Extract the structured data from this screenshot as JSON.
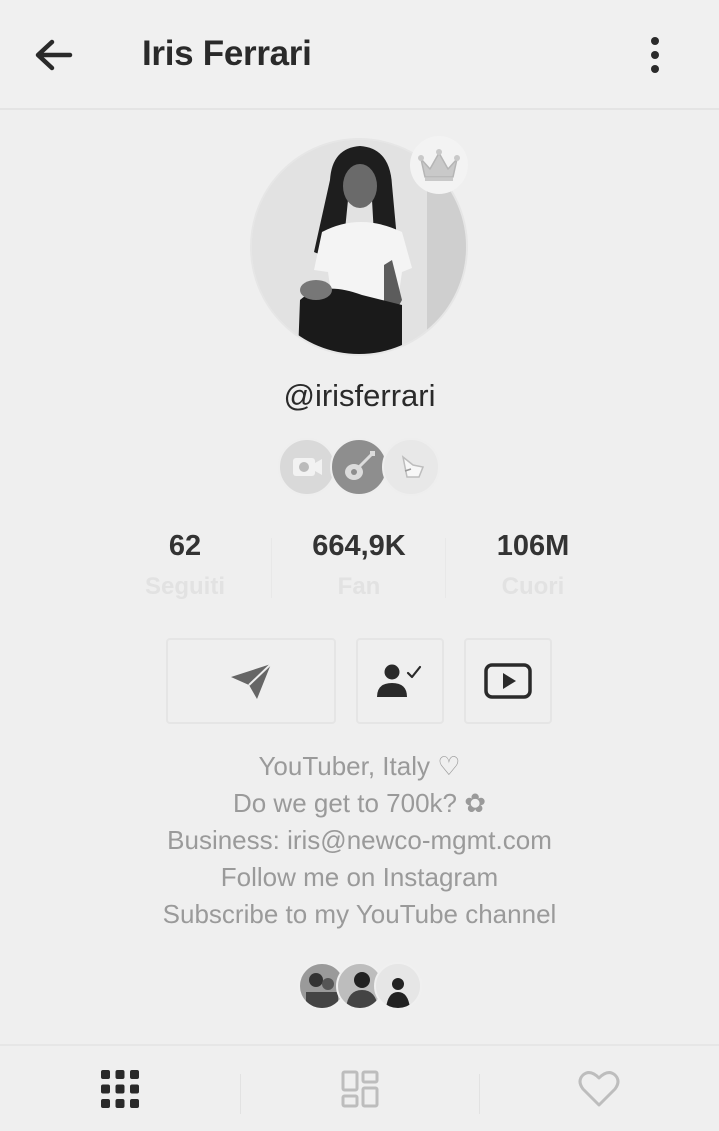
{
  "header": {
    "title": "Iris Ferrari",
    "back_icon": "arrow-left-icon",
    "more_icon": "more-vertical-icon"
  },
  "profile": {
    "username": "@irisferrari",
    "avatar_alt": "profile photo",
    "crown_icon": "crown-icon",
    "badges": [
      {
        "icon": "camera-icon"
      },
      {
        "icon": "guitar-icon"
      },
      {
        "icon": "hand-icon"
      }
    ]
  },
  "stats": [
    {
      "value": "62",
      "label": "Seguiti"
    },
    {
      "value": "664,9K",
      "label": "Fan"
    },
    {
      "value": "106M",
      "label": "Cuori"
    }
  ],
  "actions": {
    "message_icon": "send-icon",
    "follow_icon": "person-check-icon",
    "youtube_icon": "youtube-icon"
  },
  "bio": {
    "lines": [
      "YouTuber, Italy ♡",
      "Do we get to 700k? ✿",
      "Business: iris@newco-mgmt.com",
      "Follow me on Instagram",
      "Subscribe to my YouTube channel"
    ]
  },
  "tabs": [
    {
      "icon": "grid-icon",
      "active": true
    },
    {
      "icon": "collection-icon",
      "active": false
    },
    {
      "icon": "heart-icon",
      "active": false
    }
  ],
  "colors": {
    "background": "#efefef",
    "text_dark": "#2a2a2a",
    "text_muted": "#9a9a9a",
    "stat_label": "#e2e2e2"
  }
}
